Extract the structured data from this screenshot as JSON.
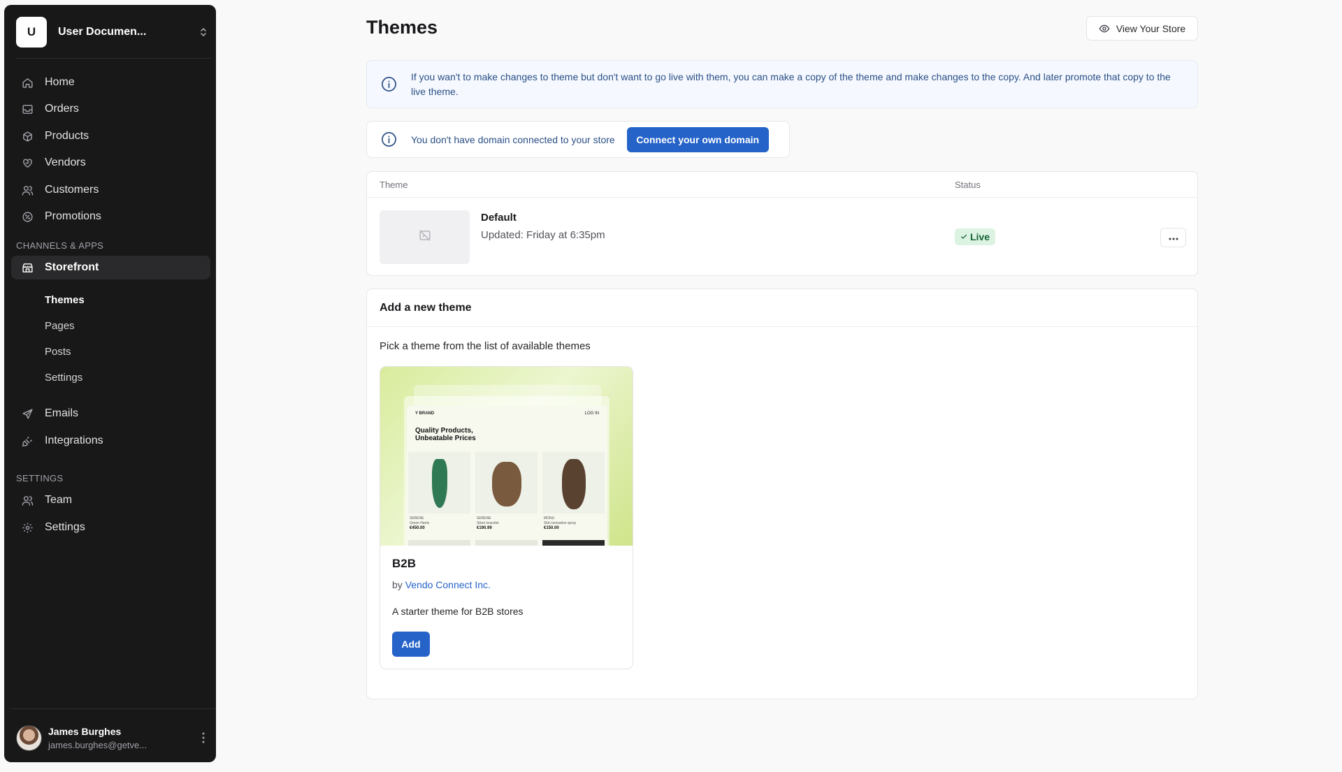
{
  "sidebar": {
    "store_initial": "U",
    "store_name": "User Documen...",
    "main_items": [
      {
        "label": "Home",
        "icon": "home-icon"
      },
      {
        "label": "Orders",
        "icon": "inbox-icon"
      },
      {
        "label": "Products",
        "icon": "box-icon"
      },
      {
        "label": "Vendors",
        "icon": "heart-handshake-icon"
      },
      {
        "label": "Customers",
        "icon": "users-icon"
      },
      {
        "label": "Promotions",
        "icon": "percent-badge-icon"
      }
    ],
    "channels_heading": "CHANNELS & APPS",
    "storefront_label": "Storefront",
    "storefront_sub": [
      "Themes",
      "Pages",
      "Posts",
      "Settings"
    ],
    "emails_label": "Emails",
    "integrations_label": "Integrations",
    "settings_heading": "SETTINGS",
    "team_label": "Team",
    "settings_label": "Settings",
    "user": {
      "name": "James Burghes",
      "email": "james.burghes@getve..."
    }
  },
  "header": {
    "title": "Themes",
    "view_store": "View Your Store"
  },
  "info": {
    "text": "If you wan't to make changes to theme but don't want to go live with them, you can make a copy of the theme and make changes to the copy. And later promote that copy to the live theme."
  },
  "domain": {
    "text": "You don't have domain connected to your store",
    "button": "Connect your own domain"
  },
  "theme_table": {
    "col_theme": "Theme",
    "col_status": "Status",
    "row": {
      "name": "Default",
      "updated": "Updated: Friday at 6:35pm",
      "status": "Live"
    }
  },
  "add_theme": {
    "title": "Add a new theme",
    "subtitle": "Pick a theme from the list of available themes",
    "card": {
      "name": "B2B",
      "by_prefix": "by",
      "author": "Vendo Connect Inc.",
      "description": "A starter theme for B2B stores",
      "button": "Add",
      "preview": {
        "brand": "Y BRAND",
        "login": "LOG IN",
        "headline_1": "Quality Products,",
        "headline_2": "Unbeatable Prices",
        "products": [
          {
            "brand": "SERENE",
            "name": "Green Heels",
            "price": "€450.00"
          },
          {
            "brand": "SERENE",
            "name": "Silver bracelet",
            "price": "€190.99"
          },
          {
            "brand": "MONU",
            "name": "Skin Ionization spray",
            "price": "€150.00"
          }
        ]
      }
    }
  },
  "colors": {
    "accent": "#2563c9",
    "sidebar_bg": "#181818",
    "live_bg": "#dcf3e4",
    "live_text": "#166534"
  }
}
